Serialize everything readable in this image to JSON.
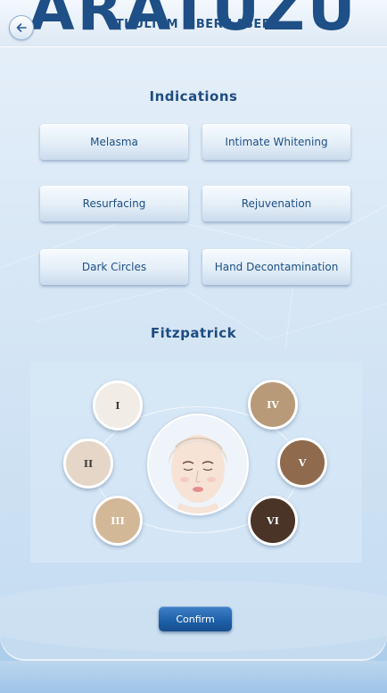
{
  "header": {
    "brand_text": "ARATUZU",
    "title": "THULIUM FIBER LASER",
    "back_icon": "arrow-left-icon"
  },
  "indications": {
    "title": "Indications",
    "items": [
      {
        "label": "Melasma"
      },
      {
        "label": "Intimate Whitening"
      },
      {
        "label": "Resurfacing"
      },
      {
        "label": "Rejuvenation"
      },
      {
        "label": "Dark Circles"
      },
      {
        "label": "Hand Decontamination"
      }
    ]
  },
  "fitzpatrick": {
    "title": "Fitzpatrick",
    "face_icon": "face-icon",
    "types": [
      {
        "label": "I",
        "color": "#f1ece6",
        "text_color": "#3d3a36"
      },
      {
        "label": "II",
        "color": "#e6d6c8",
        "text_color": "#3d3a36"
      },
      {
        "label": "III",
        "color": "#d3b898",
        "text_color": "#ffffff"
      },
      {
        "label": "IV",
        "color": "#b89a78",
        "text_color": "#ffffff"
      },
      {
        "label": "V",
        "color": "#8f6a4c",
        "text_color": "#ffffff"
      },
      {
        "label": "VI",
        "color": "#4a3427",
        "text_color": "#ffffff"
      }
    ]
  },
  "footer": {
    "confirm_label": "Confirm"
  }
}
